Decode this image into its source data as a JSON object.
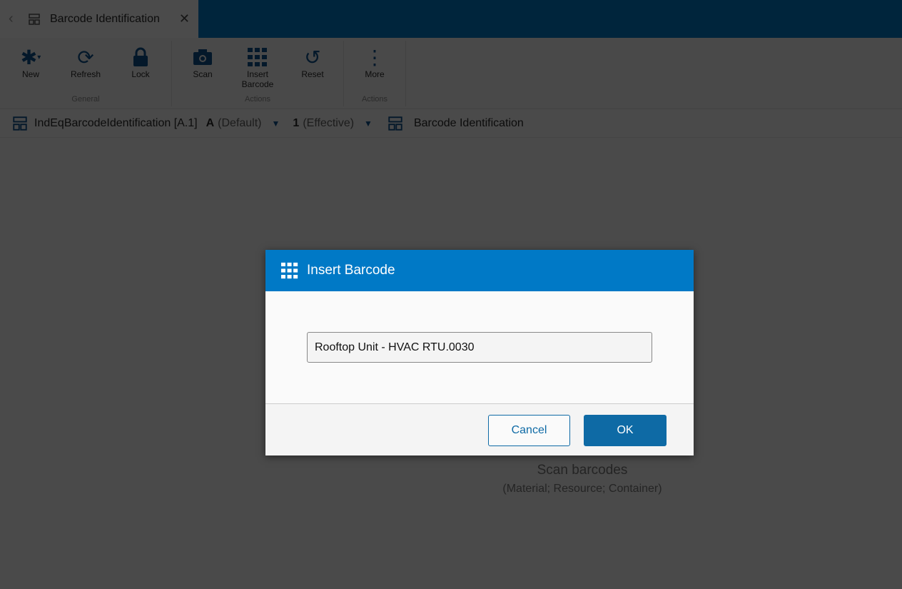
{
  "tab": {
    "title": "Barcode Identification"
  },
  "ribbon": {
    "groups": [
      {
        "label": "General"
      },
      {
        "label": "Actions"
      },
      {
        "label": "Actions"
      }
    ],
    "buttons": {
      "new": "New",
      "refresh": "Refresh",
      "lock": "Lock",
      "scan": "Scan",
      "insert": "Insert Barcode",
      "reset": "Reset",
      "more": "More"
    }
  },
  "breadcrumb": {
    "page": "IndEqBarcodeIdentification [A.1]",
    "revision": "A",
    "revision_note": "(Default)",
    "version": "1",
    "version_note": "(Effective)",
    "title": "Barcode Identification"
  },
  "main": {
    "hint": "Scan barcodes",
    "hint_sub": "(Material; Resource; Container)"
  },
  "dialog": {
    "title": "Insert Barcode",
    "value": "Rooftop Unit - HVAC RTU.0030",
    "cancel": "Cancel",
    "ok": "OK"
  }
}
